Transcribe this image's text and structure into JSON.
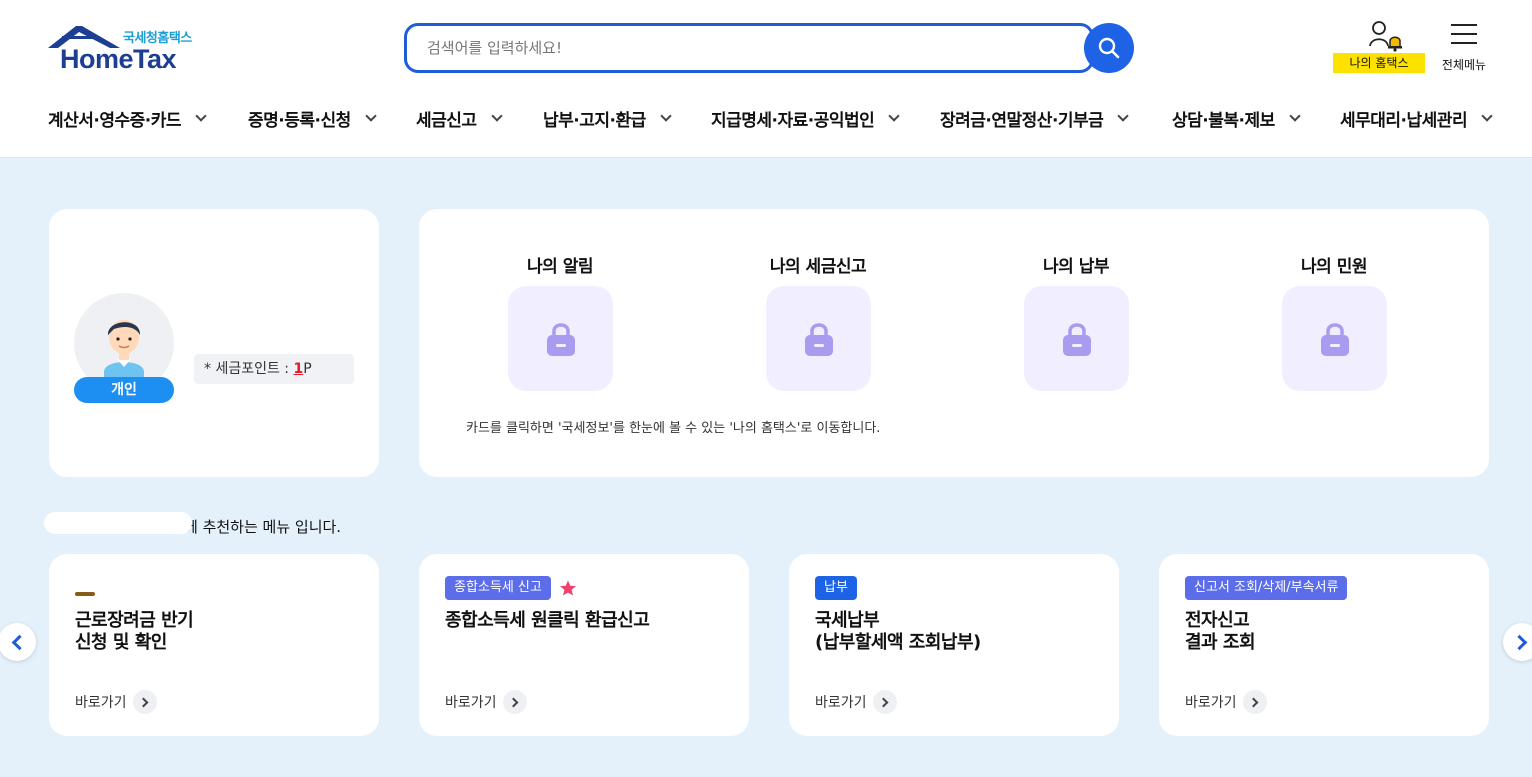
{
  "header": {
    "logo": {
      "sub": "국세청홈택스",
      "main": "HomeTax"
    },
    "search": {
      "placeholder": "검색어를 입력하세요!"
    },
    "my_hometax_label": "나의 홈택스",
    "all_menu_label": "전체메뉴"
  },
  "gnb": [
    "계산서·영수증·카드",
    "증명·등록·신청",
    "세금신고",
    "납부·고지·환급",
    "지급명세·자료·공익법인",
    "장려금·연말정산·기부금",
    "상담·불복·제보",
    "세무대리·납세관리"
  ],
  "profile": {
    "badge": "개인",
    "points_label": "* 세금포인트 : ",
    "points_value": "1",
    "points_unit": "P"
  },
  "my_section": {
    "items": [
      "나의 알림",
      "나의 세금신고",
      "나의 납부",
      "나의 민원"
    ],
    "note": "카드를 클릭하면 '국세정보'를 한눈에 볼 수 있는 '나의 홈택스'로 이동합니다."
  },
  "recommend": {
    "title_suffix": "께 추천하는 메뉴 입니다.",
    "cards": [
      {
        "tag": "",
        "star": false,
        "title": "근로장려금 반기\n신청 및 확인",
        "go": "바로가기"
      },
      {
        "tag": "종합소득세 신고",
        "star": true,
        "title": "종합소득세 원클릭 환급신고",
        "go": "바로가기"
      },
      {
        "tag": "납부",
        "star": false,
        "title": "국세납부\n(납부할세액 조회납부)",
        "go": "바로가기"
      },
      {
        "tag": "신고서 조회/삭제/부속서류",
        "star": false,
        "title": "전자신고\n결과 조회",
        "go": "바로가기"
      }
    ]
  },
  "colors": {
    "brand_blue": "#1e5cdc",
    "highlight_yellow": "#ffe100",
    "star_pink": "#f0416b",
    "lock_purple": "#a99cf0"
  },
  "icons": [
    "search-icon",
    "user-bell-icon",
    "hamburger-icon",
    "lock-icon",
    "star-icon",
    "chevron-right-icon",
    "chevron-left-icon"
  ]
}
